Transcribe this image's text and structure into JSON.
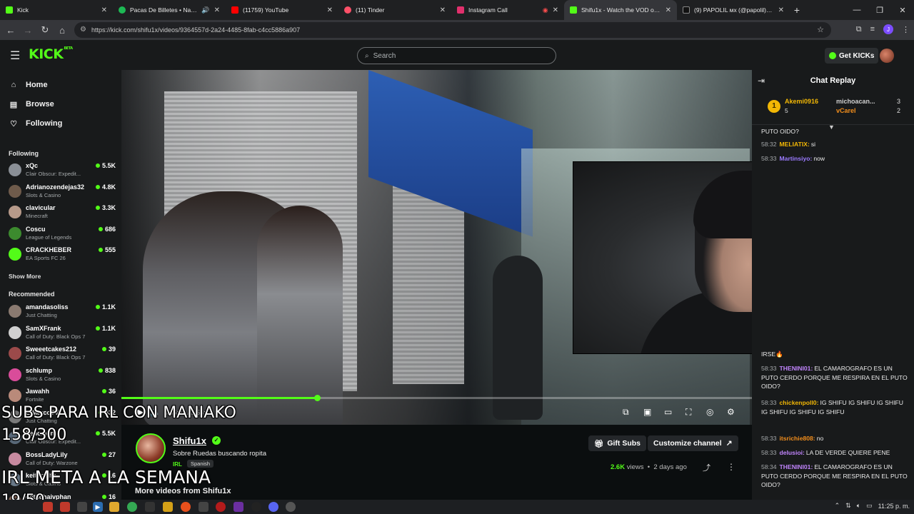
{
  "browser": {
    "tabs": [
      {
        "title": "Kick",
        "color": "#53fc18"
      },
      {
        "title": "Pacas De Billetes • Natanael",
        "color": "#1db954"
      },
      {
        "title": "(11759) YouTube",
        "color": "#ff0000"
      },
      {
        "title": "(11) Tinder",
        "color": "#fd5068"
      },
      {
        "title": "Instagram Call",
        "color": "#e1306c"
      },
      {
        "title": "Shifu1x - Watch the VOD on Ki",
        "color": "#53fc18",
        "active": true
      },
      {
        "title": "(9) PAPOLIL мх (@papolil) / X",
        "color": "#ffffff"
      }
    ],
    "url": "https://kick.com/shifu1x/videos/9364557d-2a24-4485-8fab-c4cc5886a907",
    "profile_initial": "J"
  },
  "header": {
    "logo": "KICK",
    "logo_sup": "BETA",
    "search_placeholder": "Search",
    "get_kicks": "Get KICKs"
  },
  "sidebar": {
    "nav": [
      {
        "label": "Home",
        "icon": "home-icon"
      },
      {
        "label": "Browse",
        "icon": "browse-icon"
      },
      {
        "label": "Following",
        "icon": "heart-icon"
      }
    ],
    "following_title": "Following",
    "following": [
      {
        "name": "xQc",
        "game": "Clair Obscur: Expedit...",
        "viewers": "5.5K",
        "color": "#8a8f96"
      },
      {
        "name": "Adrianozendejas32",
        "game": "Slots & Casino",
        "viewers": "4.8K",
        "color": "#6f5b4b"
      },
      {
        "name": "clavicular",
        "game": "Minecraft",
        "viewers": "3.3K",
        "color": "#b79a8a"
      },
      {
        "name": "Coscu",
        "game": "League of Legends",
        "viewers": "686",
        "color": "#3c8a2e"
      },
      {
        "name": "CRACKHEBER",
        "game": "EA Sports FC 26",
        "viewers": "555",
        "color": "#53fc18"
      }
    ],
    "show_more": "Show More",
    "recommended_title": "Recommended",
    "recommended": [
      {
        "name": "amandasoliss",
        "game": "Just Chatting",
        "viewers": "1.1K",
        "color": "#8a7a70"
      },
      {
        "name": "SamXFrank",
        "game": "Call of Duty: Black Ops 7",
        "viewers": "1.1K",
        "color": "#d0d0d0"
      },
      {
        "name": "Sweeetcakes212",
        "game": "Call of Duty: Black Ops 7",
        "viewers": "39",
        "color": "#9b4a4a"
      },
      {
        "name": "schlump",
        "game": "Slots & Casino",
        "viewers": "838",
        "color": "#d94c9a"
      },
      {
        "name": "Jawahh",
        "game": "Fortnite",
        "viewers": "36",
        "color": "#b98a7a"
      },
      {
        "name": "ElMarcoTV",
        "game": "Just Chatting",
        "viewers": "432",
        "color": "#7a7a7a"
      },
      {
        "name": "Fenomen",
        "game": "Clair Obscur: Expedit...",
        "viewers": "5.5K",
        "color": "#5a6a7a"
      },
      {
        "name": "BossLadyLily",
        "game": "Call of Duty: Warzone",
        "viewers": "27",
        "color": "#c78aa0"
      },
      {
        "name": "keithpaltv",
        "game": "Slots & Casino",
        "viewers": "16",
        "color": "#6a7a8a"
      },
      {
        "name": "dethchaivphan",
        "game": "",
        "viewers": "16",
        "color": "#8a6a5a"
      }
    ]
  },
  "video": {
    "progress": 0.31,
    "time": "3:05:04 / 9:55:14"
  },
  "overlay": {
    "line1": "SUBS PARA IRL CON MANIAKO",
    "line2": "158/300",
    "line3": "IRL META A LA SEMANA",
    "line4": "19/50"
  },
  "channel": {
    "name": "Shifu1x",
    "title": "Sobre Ruedas buscando ropita",
    "category": "IRL",
    "language": "Spanish",
    "gift_subs": "Gift Subs",
    "customize": "Customize channel",
    "views": "2.6K",
    "views_label": "views",
    "date": "2 days ago",
    "more_videos": "More videos from Shifu1x"
  },
  "chat": {
    "title": "Chat Replay",
    "top_gifters": [
      {
        "rank": "1",
        "name": "Akemi0916",
        "count": "5"
      },
      {
        "name": "michoacan...",
        "count": "3"
      },
      {
        "name": "vCarel",
        "count": "2"
      }
    ],
    "messages": [
      {
        "time": "",
        "user": "",
        "color": "#eaeaea",
        "text": "PUTO OIDO?"
      },
      {
        "time": "58:32",
        "user": "MELIATIX:",
        "color": "#f2b705",
        "text": "si"
      },
      {
        "time": "58:33",
        "user": "Martinsiyo:",
        "color": "#9b7bff",
        "text": "now"
      },
      {
        "time": "",
        "user": "",
        "color": "#eaeaea",
        "text": "IRSE🔥"
      },
      {
        "time": "58:33",
        "user": "THENINI01:",
        "color": "#c084fc",
        "text": "EL CAMAROGRAFO ES UN PUTO CERDO PORQUE ME RESPIRA EN EL PUTO OIDO?"
      },
      {
        "time": "58:33",
        "user": "chickenpoll0:",
        "color": "#f2b705",
        "text": "IG SHIFU IG SHIFU IG SHIFU IG SHIFU IG SHIFU IG SHIFU"
      },
      {
        "time": "58:33",
        "user": "itsrichie808:",
        "color": "#f28e1c",
        "text": "no"
      },
      {
        "time": "58:33",
        "user": "delusioi:",
        "color": "#c084fc",
        "text": "LA DE VERDE QUIERE PENE"
      },
      {
        "time": "58:34",
        "user": "THENINI01:",
        "color": "#c084fc",
        "text": "EL CAMAROGRAFO ES UN PUTO CERDO PORQUE ME RESPIRA EN EL PUTO OIDO?"
      }
    ]
  },
  "taskbar": {
    "time": "11:25 p. m."
  }
}
